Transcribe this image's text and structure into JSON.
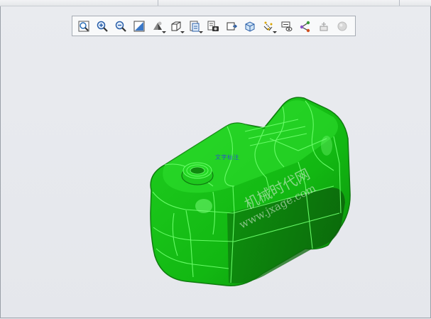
{
  "toolbar": {
    "buttons": [
      {
        "name": "refit-button",
        "icon": "refit-icon",
        "dropdown": false
      },
      {
        "name": "zoom-in-button",
        "icon": "zoom-in-icon",
        "dropdown": false
      },
      {
        "name": "zoom-out-button",
        "icon": "zoom-out-icon",
        "dropdown": false
      },
      {
        "name": "repaint-button",
        "icon": "repaint-icon",
        "dropdown": false
      },
      {
        "name": "display-style-button",
        "icon": "shading-icon",
        "dropdown": true
      },
      {
        "name": "saved-orientations-button",
        "icon": "cube-view-icon",
        "dropdown": true
      },
      {
        "name": "view-manager-button",
        "icon": "view-manager-icon",
        "dropdown": true
      },
      {
        "name": "perspective-button",
        "icon": "camera-icon",
        "dropdown": false
      },
      {
        "name": "section-button",
        "icon": "section-icon",
        "dropdown": false
      },
      {
        "name": "appearance-button",
        "icon": "box-icon",
        "dropdown": false
      },
      {
        "name": "datum-display-button",
        "icon": "datum-display-icon",
        "dropdown": true
      },
      {
        "name": "annotation-display-button",
        "icon": "annotation-display-icon",
        "dropdown": false
      },
      {
        "name": "spin-center-button",
        "icon": "spin-center-icon",
        "dropdown": false
      },
      {
        "name": "dimension-button",
        "icon": "dimension-icon",
        "dropdown": false
      },
      {
        "name": "sphere-button",
        "icon": "sphere-icon",
        "dropdown": false
      }
    ]
  },
  "model": {
    "annotation_label": "文字标注",
    "color": "#17c217"
  },
  "watermark": {
    "line1": "机械时代网",
    "line2": "www.jxage.com"
  }
}
